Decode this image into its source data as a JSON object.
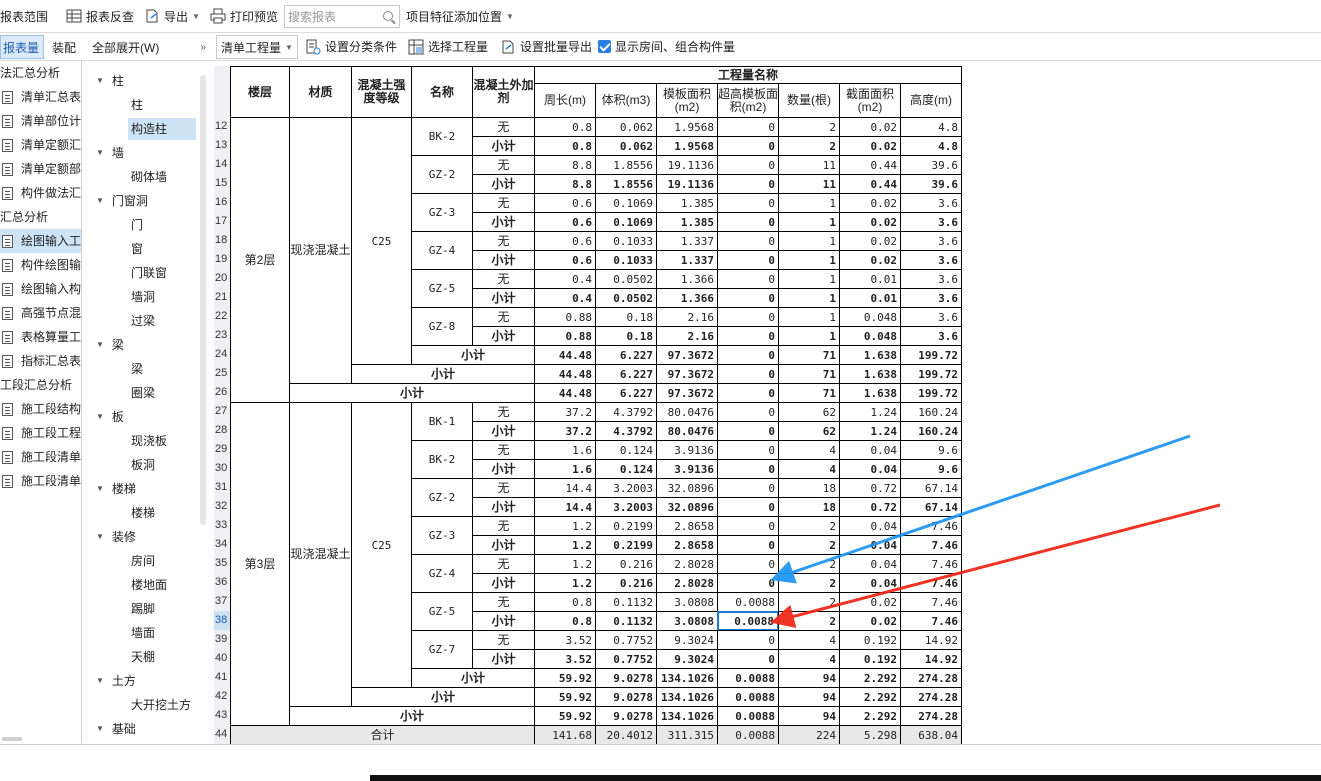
{
  "toolbar1": {
    "items": [
      "报表范围",
      "报表反查",
      "导出",
      "打印预览"
    ],
    "search_placeholder": "搜索报表",
    "feature_position": "项目特征添加位置"
  },
  "toolbar2": {
    "tab_left": "报表量",
    "tab_right": "装配",
    "expand_all": "全部展开(W)",
    "select_value": "清单工程量",
    "set_category": "设置分类条件",
    "select_quantity": "选择工程量",
    "batch_export": "设置批量导出",
    "show_rooms": "显示房间、组合构件量"
  },
  "left_panel": {
    "entries": [
      {
        "type": "group",
        "label": "法汇总分析"
      },
      {
        "type": "item",
        "label": "清单汇总表"
      },
      {
        "type": "item",
        "label": "清单部位计"
      },
      {
        "type": "item",
        "label": "清单定额汇"
      },
      {
        "type": "item",
        "label": "清单定额部"
      },
      {
        "type": "item",
        "label": "构件做法汇"
      },
      {
        "type": "group",
        "label": "汇总分析"
      },
      {
        "type": "item",
        "label": "绘图输入工",
        "selected": true
      },
      {
        "type": "item",
        "label": "构件绘图输"
      },
      {
        "type": "item",
        "label": "绘图输入构"
      },
      {
        "type": "item",
        "label": "高强节点混"
      },
      {
        "type": "item",
        "label": "表格算量工"
      },
      {
        "type": "item",
        "label": "指标汇总表"
      },
      {
        "type": "group",
        "label": "工段汇总分析"
      },
      {
        "type": "item",
        "label": "施工段结构"
      },
      {
        "type": "item",
        "label": "施工段工程"
      },
      {
        "type": "item",
        "label": "施工段清单"
      },
      {
        "type": "item",
        "label": "施工段清单"
      }
    ]
  },
  "tree": {
    "groups": [
      {
        "label": "柱",
        "children": [
          {
            "label": "柱"
          },
          {
            "label": "构造柱",
            "selected": true
          }
        ]
      },
      {
        "label": "墙",
        "children": [
          {
            "label": "砌体墙"
          }
        ]
      },
      {
        "label": "门窗洞",
        "children": [
          {
            "label": "门"
          },
          {
            "label": "窗"
          },
          {
            "label": "门联窗"
          },
          {
            "label": "墙洞"
          },
          {
            "label": "过梁"
          }
        ]
      },
      {
        "label": "梁",
        "children": [
          {
            "label": "梁"
          },
          {
            "label": "圈梁"
          }
        ]
      },
      {
        "label": "板",
        "children": [
          {
            "label": "现浇板"
          },
          {
            "label": "板洞"
          }
        ]
      },
      {
        "label": "楼梯",
        "children": [
          {
            "label": "楼梯"
          }
        ]
      },
      {
        "label": "装修",
        "children": [
          {
            "label": "房间"
          },
          {
            "label": "楼地面"
          },
          {
            "label": "踢脚"
          },
          {
            "label": "墙面"
          },
          {
            "label": "天棚"
          }
        ]
      },
      {
        "label": "土方",
        "children": [
          {
            "label": "大开挖土方"
          }
        ]
      },
      {
        "label": "基础",
        "children": []
      }
    ]
  },
  "table": {
    "headers": {
      "floor": "楼层",
      "material": "材质",
      "strength": "混凝土强度等级",
      "name": "名称",
      "additive": "混凝土外加剂",
      "group": "工程量名称",
      "cols": [
        "周长(m)",
        "体积(m3)",
        "模板面积(m2)",
        "超高模板面积(m2)",
        "数量(根)",
        "截面面积(m2)",
        "高度(m)"
      ]
    },
    "row_numbers": [
      "12",
      "13",
      "14",
      "15",
      "16",
      "17",
      "18",
      "19",
      "20",
      "21",
      "22",
      "23",
      "24",
      "25",
      "26",
      "27",
      "28",
      "29",
      "30",
      "31",
      "32",
      "33",
      "34",
      "35",
      "36",
      "37",
      "38",
      "39",
      "40",
      "41",
      "42",
      "43",
      "44"
    ],
    "selected_row": "38",
    "floors": [
      {
        "floor": "第2层",
        "material": "现浇混凝土",
        "strength": "C25",
        "components": [
          {
            "name": "BK-2",
            "rows": [
              [
                "无",
                "0.8",
                "0.062",
                "1.9568",
                "0",
                "2",
                "0.02",
                "4.8"
              ],
              [
                "小计",
                "0.8",
                "0.062",
                "1.9568",
                "0",
                "2",
                "0.02",
                "4.8"
              ]
            ]
          },
          {
            "name": "GZ-2",
            "rows": [
              [
                "无",
                "8.8",
                "1.8556",
                "19.1136",
                "0",
                "11",
                "0.44",
                "39.6"
              ],
              [
                "小计",
                "8.8",
                "1.8556",
                "19.1136",
                "0",
                "11",
                "0.44",
                "39.6"
              ]
            ]
          },
          {
            "name": "GZ-3",
            "rows": [
              [
                "无",
                "0.6",
                "0.1069",
                "1.385",
                "0",
                "1",
                "0.02",
                "3.6"
              ],
              [
                "小计",
                "0.6",
                "0.1069",
                "1.385",
                "0",
                "1",
                "0.02",
                "3.6"
              ]
            ]
          },
          {
            "name": "GZ-4",
            "rows": [
              [
                "无",
                "0.6",
                "0.1033",
                "1.337",
                "0",
                "1",
                "0.02",
                "3.6"
              ],
              [
                "小计",
                "0.6",
                "0.1033",
                "1.337",
                "0",
                "1",
                "0.02",
                "3.6"
              ]
            ]
          },
          {
            "name": "GZ-5",
            "rows": [
              [
                "无",
                "0.4",
                "0.0502",
                "1.366",
                "0",
                "1",
                "0.01",
                "3.6"
              ],
              [
                "小计",
                "0.4",
                "0.0502",
                "1.366",
                "0",
                "1",
                "0.01",
                "3.6"
              ]
            ]
          },
          {
            "name": "GZ-8",
            "rows": [
              [
                "无",
                "0.88",
                "0.18",
                "2.16",
                "0",
                "1",
                "0.048",
                "3.6"
              ],
              [
                "小计",
                "0.88",
                "0.18",
                "2.16",
                "0",
                "1",
                "0.048",
                "3.6"
              ]
            ]
          }
        ],
        "subtotals": [
          [
            "小计",
            "44.48",
            "6.227",
            "97.3672",
            "0",
            "71",
            "1.638",
            "199.72"
          ],
          [
            "小计",
            "44.48",
            "6.227",
            "97.3672",
            "0",
            "71",
            "1.638",
            "199.72"
          ],
          [
            "小计",
            "44.48",
            "6.227",
            "97.3672",
            "0",
            "71",
            "1.638",
            "199.72"
          ]
        ]
      },
      {
        "floor": "第3层",
        "material": "现浇混凝土",
        "strength": "C25",
        "components": [
          {
            "name": "BK-1",
            "rows": [
              [
                "无",
                "37.2",
                "4.3792",
                "80.0476",
                "0",
                "62",
                "1.24",
                "160.24"
              ],
              [
                "小计",
                "37.2",
                "4.3792",
                "80.0476",
                "0",
                "62",
                "1.24",
                "160.24"
              ]
            ]
          },
          {
            "name": "BK-2",
            "rows": [
              [
                "无",
                "1.6",
                "0.124",
                "3.9136",
                "0",
                "4",
                "0.04",
                "9.6"
              ],
              [
                "小计",
                "1.6",
                "0.124",
                "3.9136",
                "0",
                "4",
                "0.04",
                "9.6"
              ]
            ]
          },
          {
            "name": "GZ-2",
            "rows": [
              [
                "无",
                "14.4",
                "3.2003",
                "32.0896",
                "0",
                "18",
                "0.72",
                "67.14"
              ],
              [
                "小计",
                "14.4",
                "3.2003",
                "32.0896",
                "0",
                "18",
                "0.72",
                "67.14"
              ]
            ]
          },
          {
            "name": "GZ-3",
            "rows": [
              [
                "无",
                "1.2",
                "0.2199",
                "2.8658",
                "0",
                "2",
                "0.04",
                "7.46"
              ],
              [
                "小计",
                "1.2",
                "0.2199",
                "2.8658",
                "0",
                "2",
                "0.04",
                "7.46"
              ]
            ]
          },
          {
            "name": "GZ-4",
            "rows": [
              [
                "无",
                "1.2",
                "0.216",
                "2.8028",
                "0",
                "2",
                "0.04",
                "7.46"
              ],
              [
                "小计",
                "1.2",
                "0.216",
                "2.8028",
                "0",
                "2",
                "0.04",
                "7.46"
              ]
            ]
          },
          {
            "name": "GZ-5",
            "rows": [
              [
                "无",
                "0.8",
                "0.1132",
                "3.0808",
                "0.0088",
                "2",
                "0.02",
                "7.46"
              ],
              [
                "小计",
                "0.8",
                "0.1132",
                "3.0808",
                "0.0088",
                "2",
                "0.02",
                "7.46"
              ]
            ]
          },
          {
            "name": "GZ-7",
            "rows": [
              [
                "无",
                "3.52",
                "0.7752",
                "9.3024",
                "0",
                "4",
                "0.192",
                "14.92"
              ],
              [
                "小计",
                "3.52",
                "0.7752",
                "9.3024",
                "0",
                "4",
                "0.192",
                "14.92"
              ]
            ]
          }
        ],
        "subtotals": [
          [
            "小计",
            "59.92",
            "9.0278",
            "134.1026",
            "0.0088",
            "94",
            "2.292",
            "274.28"
          ],
          [
            "小计",
            "59.92",
            "9.0278",
            "134.1026",
            "0.0088",
            "94",
            "2.292",
            "274.28"
          ],
          [
            "小计",
            "59.92",
            "9.0278",
            "134.1026",
            "0.0088",
            "94",
            "2.292",
            "274.28"
          ]
        ]
      }
    ],
    "total": [
      "合计",
      "141.68",
      "20.4012",
      "311.315",
      "0.0088",
      "224",
      "5.298",
      "638.04"
    ]
  },
  "colors": {
    "accent": "#2a7de1",
    "selection": "#cde4f7",
    "arrow_blue": "#2196f3",
    "arrow_red": "#f02a1a"
  }
}
